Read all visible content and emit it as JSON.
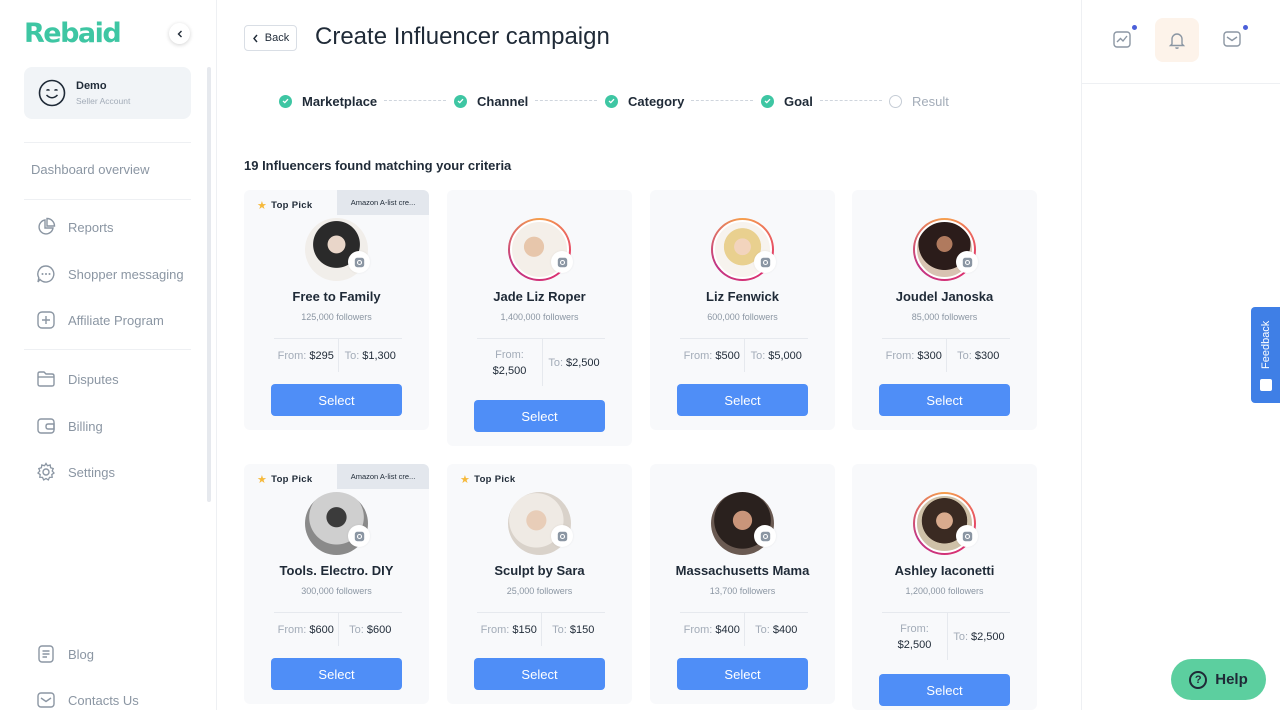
{
  "brand": {
    "logo_text": "Rebaid",
    "accent": "#3ec6a3"
  },
  "sidebar": {
    "account": {
      "name": "Demo",
      "role": "Seller Account"
    },
    "items": [
      {
        "label": "Dashboard overview",
        "icon": "none"
      },
      {
        "label": "Reports",
        "icon": "pie-chart-icon"
      },
      {
        "label": "Shopper messaging",
        "icon": "chat-bubble-icon"
      },
      {
        "label": "Affiliate Program",
        "icon": "plus-square-icon"
      },
      {
        "label": "Disputes",
        "icon": "folder-icon"
      },
      {
        "label": "Billing",
        "icon": "wallet-icon"
      },
      {
        "label": "Settings",
        "icon": "gear-icon"
      },
      {
        "label": "Blog",
        "icon": "document-icon"
      },
      {
        "label": "Contacts Us",
        "icon": "mail-icon"
      }
    ]
  },
  "header": {
    "back_label": "Back",
    "title": "Create Influencer campaign"
  },
  "steps": [
    {
      "label": "Marketplace",
      "done": true
    },
    {
      "label": "Channel",
      "done": true
    },
    {
      "label": "Category",
      "done": true
    },
    {
      "label": "Goal",
      "done": true
    },
    {
      "label": "Result",
      "done": false
    }
  ],
  "results_text": "19 Influencers found matching your criteria",
  "labels": {
    "from": "From:",
    "to": "To:",
    "select": "Select",
    "top_pick": "Top Pick",
    "amazon_badge": "Amazon A-list cre..."
  },
  "influencers": [
    {
      "name": "Free to Family",
      "followers": "125,000 followers",
      "from": "$295",
      "to": "$1,300",
      "top_pick": true,
      "amazon": true
    },
    {
      "name": "Jade Liz Roper",
      "followers": "1,400,000 followers",
      "from": "$2,500",
      "to": "$2,500",
      "top_pick": false,
      "amazon": false
    },
    {
      "name": "Liz Fenwick",
      "followers": "600,000 followers",
      "from": "$500",
      "to": "$5,000",
      "top_pick": false,
      "amazon": false
    },
    {
      "name": "Joudel Janoska",
      "followers": "85,000 followers",
      "from": "$300",
      "to": "$300",
      "top_pick": false,
      "amazon": false
    },
    {
      "name": "Tools. Electro. DIY",
      "followers": "300,000 followers",
      "from": "$600",
      "to": "$600",
      "top_pick": true,
      "amazon": true
    },
    {
      "name": "Sculpt by Sara",
      "followers": "25,000 followers",
      "from": "$150",
      "to": "$150",
      "top_pick": true,
      "amazon": false
    },
    {
      "name": "Massachusetts Mama",
      "followers": "13,700 followers",
      "from": "$400",
      "to": "$400",
      "top_pick": false,
      "amazon": false
    },
    {
      "name": "Ashley Iaconetti",
      "followers": "1,200,000 followers",
      "from": "$2,500",
      "to": "$2,500",
      "top_pick": false,
      "amazon": false
    }
  ],
  "floating": {
    "feedback": "Feedback",
    "help": "Help"
  },
  "colors": {
    "primary_button": "#4f8ef7",
    "step_check": "#3ec6a3",
    "help_bg": "#5ccf9f",
    "feedback_bg": "#3f7fe6"
  }
}
